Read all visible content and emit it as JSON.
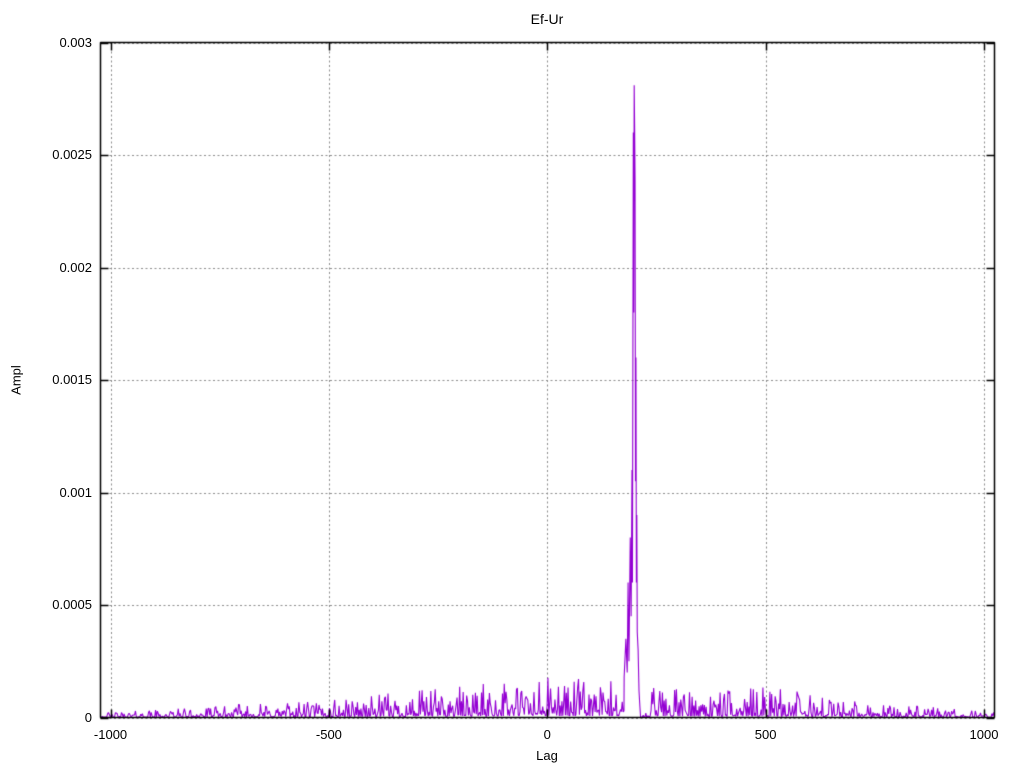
{
  "chart_data": {
    "type": "line",
    "title": "Ef-Ur",
    "xlabel": "Lag",
    "ylabel": "Ampl",
    "xlim": [
      -1023,
      1024
    ],
    "ylim": [
      0,
      0.003
    ],
    "x_ticks": [
      -1000,
      -500,
      0,
      500,
      1000
    ],
    "x_tick_labels": [
      "-1000",
      "-500",
      "0",
      "500",
      "1000"
    ],
    "y_ticks": [
      0,
      0.0005,
      0.001,
      0.0015,
      0.002,
      0.0025,
      0.003
    ],
    "y_tick_labels": [
      "0",
      "0.0005",
      "0.001",
      "0.0015",
      "0.002",
      "0.0025",
      "0.003"
    ],
    "grid": true,
    "legend": "none",
    "line_color": "#9400d3",
    "grid_color": "#8c8c8c",
    "border_color": "#000000",
    "background_color": "#ffffff",
    "n_points": 1024,
    "noise_seed": 42,
    "peak": {
      "lag": 199,
      "value": 0.00281
    },
    "peak_profile": [
      [
        176,
        0.00018
      ],
      [
        180,
        0.00035
      ],
      [
        183,
        0.0002
      ],
      [
        185,
        0.0006
      ],
      [
        187,
        0.00025
      ],
      [
        190,
        0.0008
      ],
      [
        192,
        0.00045
      ],
      [
        194,
        0.0011
      ],
      [
        195,
        0.0006
      ],
      [
        196,
        0.0016
      ],
      [
        197,
        0.0026
      ],
      [
        198,
        0.0018
      ],
      [
        199,
        0.00281
      ],
      [
        200,
        0.00262
      ],
      [
        201,
        0.00238
      ],
      [
        202,
        0.00105
      ],
      [
        203,
        0.0016
      ],
      [
        204,
        0.0006
      ],
      [
        205,
        0.0009
      ],
      [
        206,
        0.00038
      ],
      [
        208,
        0.0003
      ],
      [
        210,
        0.00012
      ],
      [
        212,
        5e-05
      ]
    ],
    "quiet_zone": [
      212,
      234
    ],
    "quiet_zone_factor": 0.15,
    "noise_envelope": [
      [
        -1023,
        2e-05
      ],
      [
        -900,
        3.5e-05
      ],
      [
        -800,
        4.5e-05
      ],
      [
        -700,
        6e-05
      ],
      [
        -600,
        7e-05
      ],
      [
        -500,
        8e-05
      ],
      [
        -400,
        0.0001
      ],
      [
        -300,
        0.00012
      ],
      [
        -200,
        0.00014
      ],
      [
        -100,
        0.00016
      ],
      [
        0,
        0.00018
      ],
      [
        100,
        0.00017
      ],
      [
        200,
        0.00016
      ],
      [
        300,
        0.00013
      ],
      [
        400,
        0.00012
      ],
      [
        530,
        0.00014
      ],
      [
        650,
        9e-05
      ],
      [
        800,
        6e-05
      ],
      [
        950,
        3.5e-05
      ],
      [
        1024,
        2.5e-05
      ]
    ]
  }
}
